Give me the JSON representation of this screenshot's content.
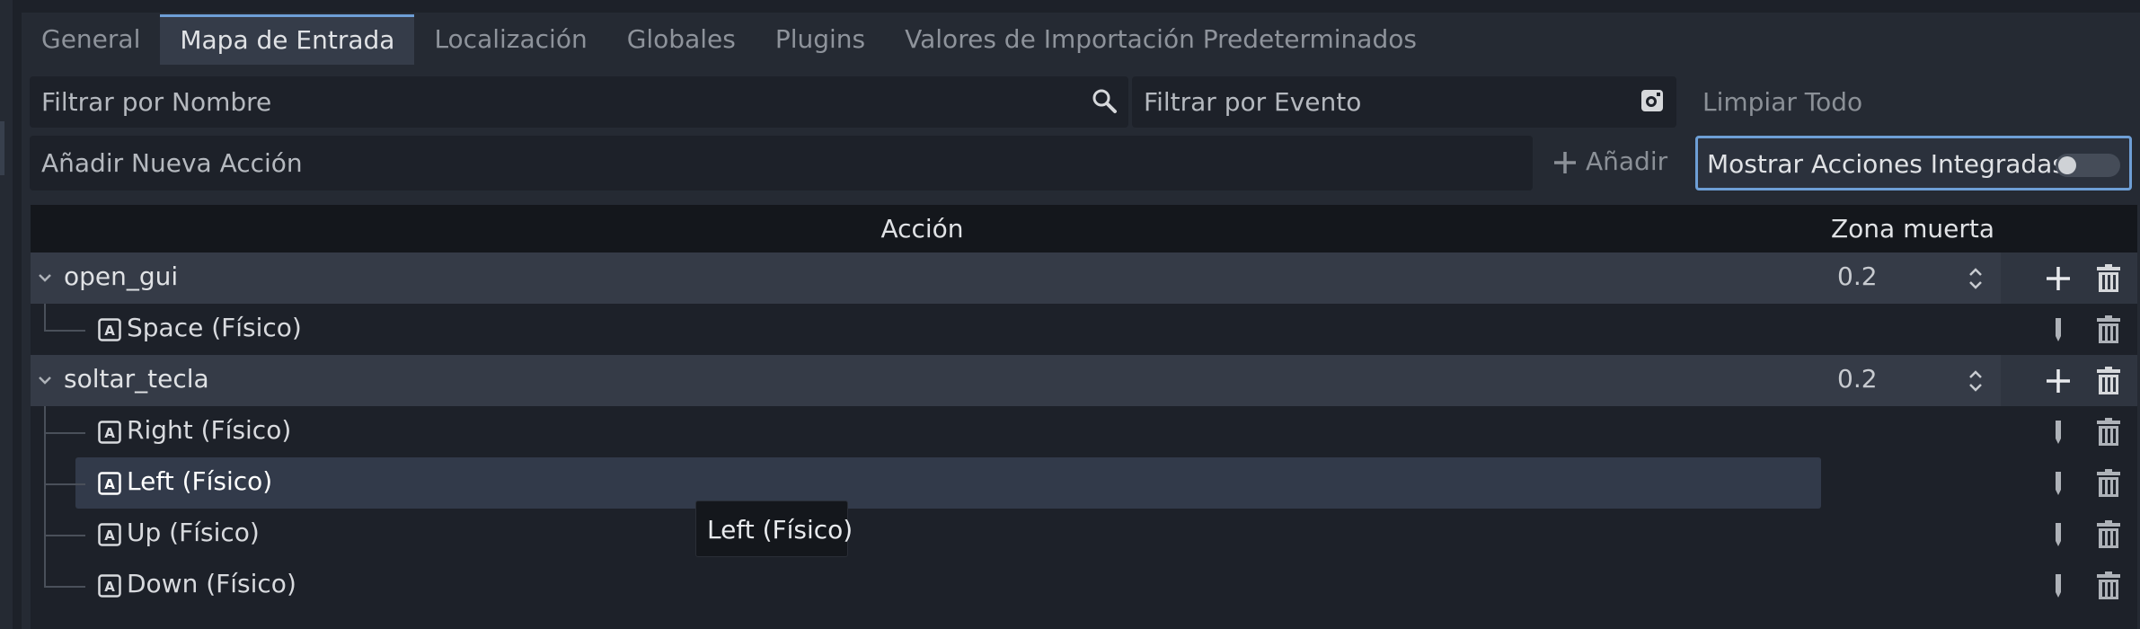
{
  "tabs": [
    {
      "label": "General"
    },
    {
      "label": "Mapa de Entrada"
    },
    {
      "label": "Localización"
    },
    {
      "label": "Globales"
    },
    {
      "label": "Plugins"
    },
    {
      "label": "Valores de Importación Predeterminados"
    }
  ],
  "active_tab": "Mapa de Entrada",
  "filter": {
    "name_placeholder": "Filtrar por Nombre",
    "event_placeholder": "Filtrar por Evento",
    "clear_all_label": "Limpiar Todo"
  },
  "add_action": {
    "placeholder": "Añadir Nueva Acción",
    "add_label": "Añadir"
  },
  "builtin_toggle": {
    "label": "Mostrar Acciones Integradas",
    "enabled": false
  },
  "table": {
    "col_action": "Acción",
    "col_deadzone": "Zona muerta",
    "actions": [
      {
        "name": "open_gui",
        "deadzone": "0.2",
        "events": [
          "Space (Físico)"
        ]
      },
      {
        "name": "soltar_tecla",
        "deadzone": "0.2",
        "events": [
          "Right (Físico)",
          "Left (Físico)",
          "Up (Físico)",
          "Down (Físico)"
        ]
      }
    ]
  },
  "tooltip": "Left (Físico)",
  "colors": {
    "accent": "#6e9fd6",
    "background": "#1d2129",
    "panel": "#252a33"
  }
}
